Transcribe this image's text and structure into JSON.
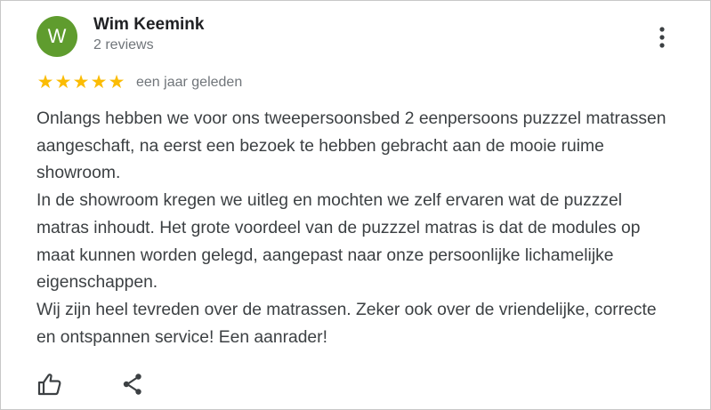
{
  "review": {
    "avatar_letter": "W",
    "avatar_color": "#5f9c2e",
    "author": "Wim Keemink",
    "review_count": "2 reviews",
    "rating": 5,
    "stars": [
      "★",
      "★",
      "★",
      "★",
      "★"
    ],
    "star_color": "#fbbc04",
    "time": "een jaar geleden",
    "text": "Onlangs hebben we voor ons tweepersoonsbed 2 eenpersoons puzzzel matrassen aangeschaft, na eerst een bezoek te hebben gebracht aan de mooie ruime showroom.\nIn de showroom kregen we uitleg en mochten we zelf ervaren wat de puzzzel matras inhoudt. Het grote voordeel van de puzzzel matras is dat de modules op maat kunnen worden gelegd, aangepast naar onze persoonlijke lichamelijke eigenschappen.\nWij zijn heel tevreden over de matrassen. Zeker ook over de vriendelijke, correcte en ontspannen service! Een aanrader!"
  },
  "icons": {
    "more": "more-vert-icon",
    "like": "thumbs-up-icon",
    "share": "share-icon"
  }
}
